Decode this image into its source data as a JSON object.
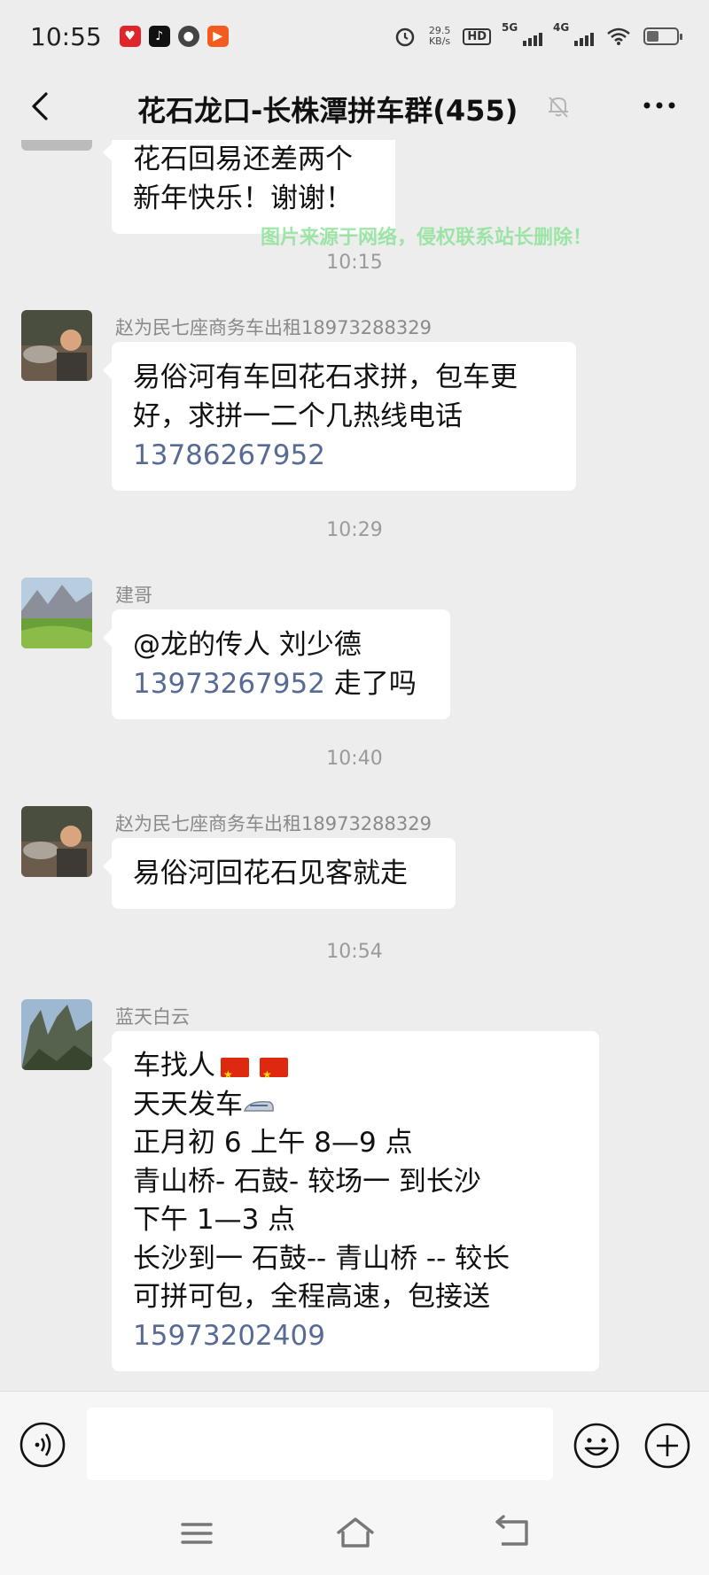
{
  "status_bar": {
    "time": "10:55",
    "speed_value": "29.5",
    "speed_unit": "KB/s",
    "hd_label": "HD",
    "net1": "5G",
    "net2": "4G",
    "battery_level": 0.4
  },
  "header": {
    "title": "花石龙口-长株潭拼车群(455)",
    "icons": [
      "back-icon",
      "mute-bell-icon",
      "more-icon"
    ]
  },
  "watermark": "图片来源于网络，侵权联系站长删除！",
  "messages": [
    {
      "type": "partial",
      "lines": [
        "花石回易还差两个",
        "新年快乐！谢谢！"
      ]
    },
    {
      "timestamp": "10:15",
      "sender": "赵为民七座商务车出租18973288329",
      "lines": [
        "易俗河有车回花石求拼，包车更",
        "好，求拼一二个几热线电话"
      ],
      "phone": "13786267952"
    },
    {
      "timestamp": "10:29",
      "sender": "建哥",
      "line1": "@龙的传人  刘少德",
      "phone": "13973267952",
      "after_phone": " 走了吗"
    },
    {
      "timestamp": "10:40",
      "sender": "赵为民七座商务车出租18973288329",
      "text": "易俗河回花石见客就走"
    },
    {
      "timestamp": "10:54",
      "sender": "蓝天白云",
      "line1": "车找人",
      "line2": "天天发车",
      "line3": "正月初 6 上午 8—9 点",
      "line4": "青山桥-  石鼓-  较场一    到长沙",
      "line5": "下午 1—3 点",
      "line6": "长沙到一 石鼓-- 青山桥  --  较长",
      "line7": "可拼可包，全程高速，包接送",
      "phone": "15973202409"
    }
  ]
}
